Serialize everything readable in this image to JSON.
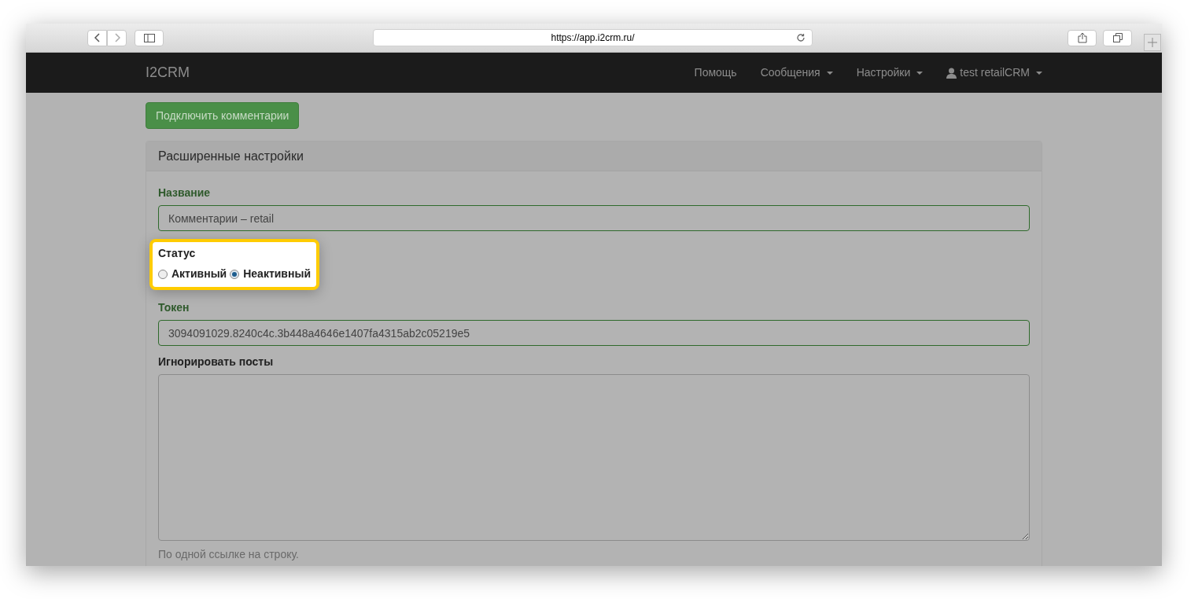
{
  "browser": {
    "url": "https://app.i2crm.ru/"
  },
  "navbar": {
    "brand": "I2CRM",
    "items": [
      {
        "label": "Помощь",
        "dropdown": false,
        "kind": "link"
      },
      {
        "label": "Сообщения",
        "dropdown": true,
        "kind": "link"
      },
      {
        "label": "Настройки",
        "dropdown": true,
        "kind": "link"
      },
      {
        "label": "test retailCRM",
        "dropdown": true,
        "kind": "user"
      }
    ]
  },
  "connect_button": "Подключить комментарии",
  "panel": {
    "title": "Расширенные настройки",
    "fields": [
      {
        "kind": "text",
        "label": "Название",
        "value": "Комментарии – retail",
        "valid": true
      },
      {
        "kind": "radio",
        "label": "Статус",
        "highlighted": true,
        "options": [
          {
            "label": "Активный",
            "selected": false
          },
          {
            "label": "Неактивный",
            "selected": true
          }
        ]
      },
      {
        "kind": "text",
        "label": "Токен",
        "value": "3094091029.8240c4c.3b448a4646e1407fa4315ab2c05219e5",
        "valid": true
      },
      {
        "kind": "textarea",
        "label": "Игнорировать посты",
        "valid": false,
        "help": "По одной ссылке на строку."
      }
    ]
  }
}
